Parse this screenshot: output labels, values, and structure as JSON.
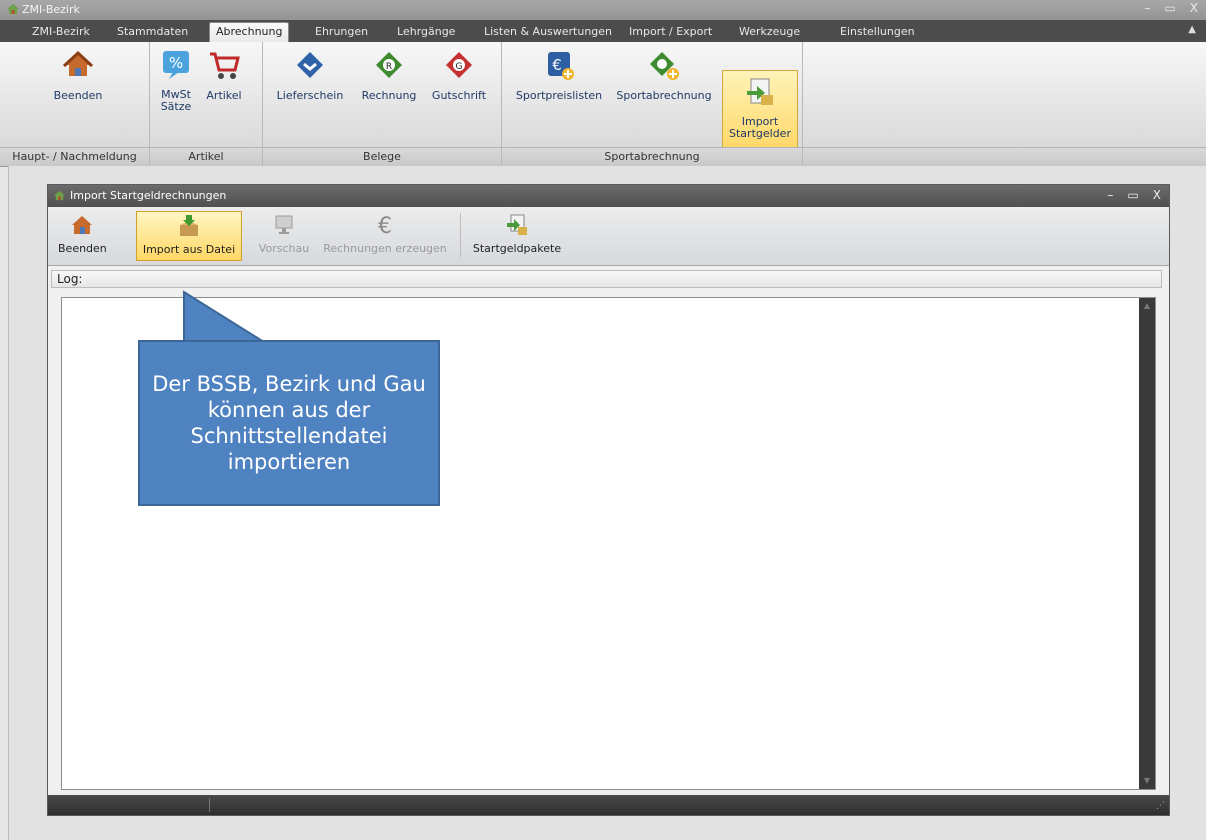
{
  "app": {
    "title": "ZMI-Bezirk"
  },
  "menu": {
    "tabs": [
      "ZMI-Bezirk",
      "Stammdaten",
      "Abrechnung",
      "Ehrungen",
      "Lehrgänge",
      "Listen & Auswertungen",
      "Import / Export",
      "Werkzeuge",
      "Einstellungen"
    ],
    "active": "Abrechnung"
  },
  "ribbon": {
    "buttons": {
      "beenden": "Beenden",
      "mwst": "MwSt\nSätze",
      "artikel": "Artikel",
      "lieferschein": "Lieferschein",
      "rechnung": "Rechnung",
      "gutschrift": "Gutschrift",
      "sportpreislisten": "Sportpreislisten",
      "sportabrechnung": "Sportabrechnung",
      "import_startgelder": "Import\nStartgelder"
    },
    "groups": {
      "haupt": "Haupt- / Nachmeldung",
      "artikel": "Artikel",
      "belege": "Belege",
      "sportabrechnung": "Sportabrechnung"
    }
  },
  "child": {
    "title": "Import Startgeldrechnungen",
    "toolbar": {
      "beenden": "Beenden",
      "import_datei": "Import aus Datei",
      "vorschau": "Vorschau",
      "rechnungen": "Rechnungen erzeugen",
      "startgeldpakete": "Startgeldpakete"
    },
    "log_label": "Log:"
  },
  "callout": {
    "text": "Der BSSB, Bezirk und Gau können aus der Schnittstellendatei importieren"
  },
  "colors": {
    "callout": "#4f82c0",
    "highlight": "#ffd86a",
    "menubar": "#4c4c4c"
  }
}
